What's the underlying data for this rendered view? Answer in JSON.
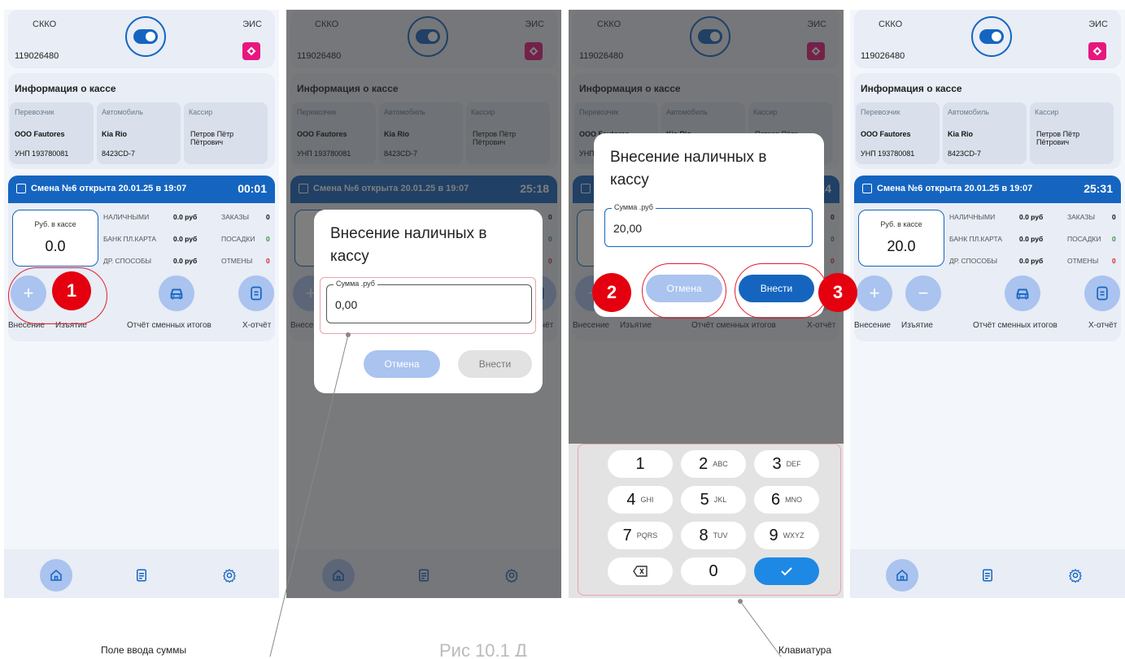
{
  "screens": [
    {
      "skko_label": "СККО",
      "skko_number": "119026480",
      "eis_label": "ЭИС",
      "info_title": "Информация о кассе",
      "info_cols": [
        {
          "head": "Перевозчик",
          "value": "ООО Fautores",
          "sub": "УНП 193780081"
        },
        {
          "head": "Автомобиль",
          "value": "Kia Rio",
          "sub": "8423CD-7"
        },
        {
          "head": "Кассир",
          "value": "Петров Пётр Пётрович",
          "sub": ""
        }
      ],
      "shift_text": "Смена №6 открыта 20.01.25 в 19:07",
      "shift_timer": "00:01",
      "cash_label": "Руб. в кассе",
      "cash_value": "0.0",
      "stats": {
        "cash_label": "НАЛИЧНЫМИ",
        "cash_val": "0.0 руб",
        "card_label": "БАНК ПЛ.КАРТА",
        "card_val": "0.0 руб",
        "other_label": "ДР. СПОСОБЫ",
        "other_val": "0.0 руб",
        "orders_label": "ЗАКАЗЫ",
        "orders_val": "0",
        "land_label": "ПОСАДКИ",
        "land_val": "0",
        "cancel_label": "ОТМЕНЫ",
        "cancel_val": "0"
      },
      "actions": {
        "deposit": "Внесение",
        "withdraw": "Изъятие",
        "report": "Отчёт сменных итогов",
        "xreport": "Х-отчёт"
      }
    },
    {
      "shift_timer": "25:18"
    },
    {
      "shift_timer": "24"
    },
    {
      "shift_timer": "25:31",
      "cash_value": "20.0"
    }
  ],
  "dialog1": {
    "title": "Внесение наличных в кассу",
    "field_label": "Сумма .руб",
    "field_value": "0,00",
    "cancel": "Отмена",
    "submit": "Внести"
  },
  "dialog2": {
    "title": "Внесение наличных в кассу",
    "field_label": "Сумма .руб",
    "field_value": "20,00",
    "cancel": "Отмена",
    "submit": "Внести"
  },
  "keypad": [
    [
      "1",
      ""
    ],
    [
      "2",
      "ABC"
    ],
    [
      "3",
      "DEF"
    ],
    [
      "4",
      "GHI"
    ],
    [
      "5",
      "JKL"
    ],
    [
      "6",
      "MNO"
    ],
    [
      "7",
      "PQRS"
    ],
    [
      "8",
      "TUV"
    ],
    [
      "9",
      "WXYZ"
    ],
    [
      "",
      ""
    ],
    [
      "0",
      ""
    ],
    [
      "",
      ""
    ]
  ],
  "steps": [
    "1",
    "2",
    "3"
  ],
  "captions": {
    "field": "Поле ввода суммы",
    "center": "Рис 10.1 Д",
    "keyboard": "Клавиатура"
  },
  "colors": {
    "primary": "#1565c0",
    "light": "#aac3ef",
    "marker": "#e4000f",
    "eis": "#e6177e"
  }
}
